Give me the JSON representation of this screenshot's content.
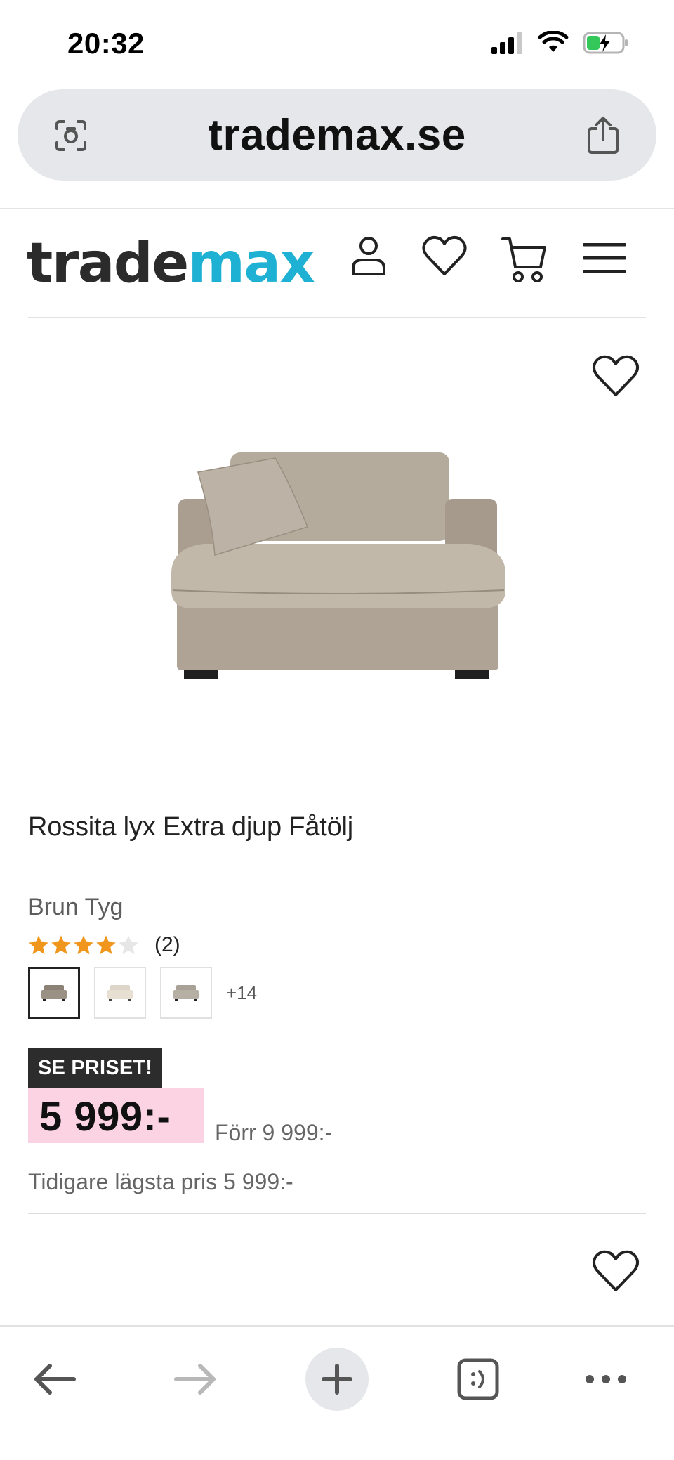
{
  "status_bar": {
    "time": "20:32"
  },
  "browser": {
    "url": "trademax.se"
  },
  "site": {
    "logo_part1": "trade",
    "logo_part2": "max",
    "logo_colors": {
      "dark": "#2b2b2b",
      "accent": "#1fb1d3"
    }
  },
  "product": {
    "title": "Rossita lyx Extra djup Fåtölj",
    "variant": "Brun Tyg",
    "rating": 4,
    "rating_max": 5,
    "rating_count": "(2)",
    "swatches_more": "+14",
    "price_badge": "SE PRISET!",
    "price": "5 999:-",
    "old_price": "Förr 9 999:-",
    "lowest_price": "Tidigare lägsta pris 5 999:-"
  },
  "icons": {
    "url_left": "scan-icon",
    "url_right": "share-icon",
    "header": [
      "user-icon",
      "heart-icon",
      "cart-icon",
      "menu-icon"
    ],
    "toolbar": [
      "back-arrow-icon",
      "forward-arrow-icon",
      "plus-icon",
      "tabs-icon",
      "more-icon"
    ]
  }
}
